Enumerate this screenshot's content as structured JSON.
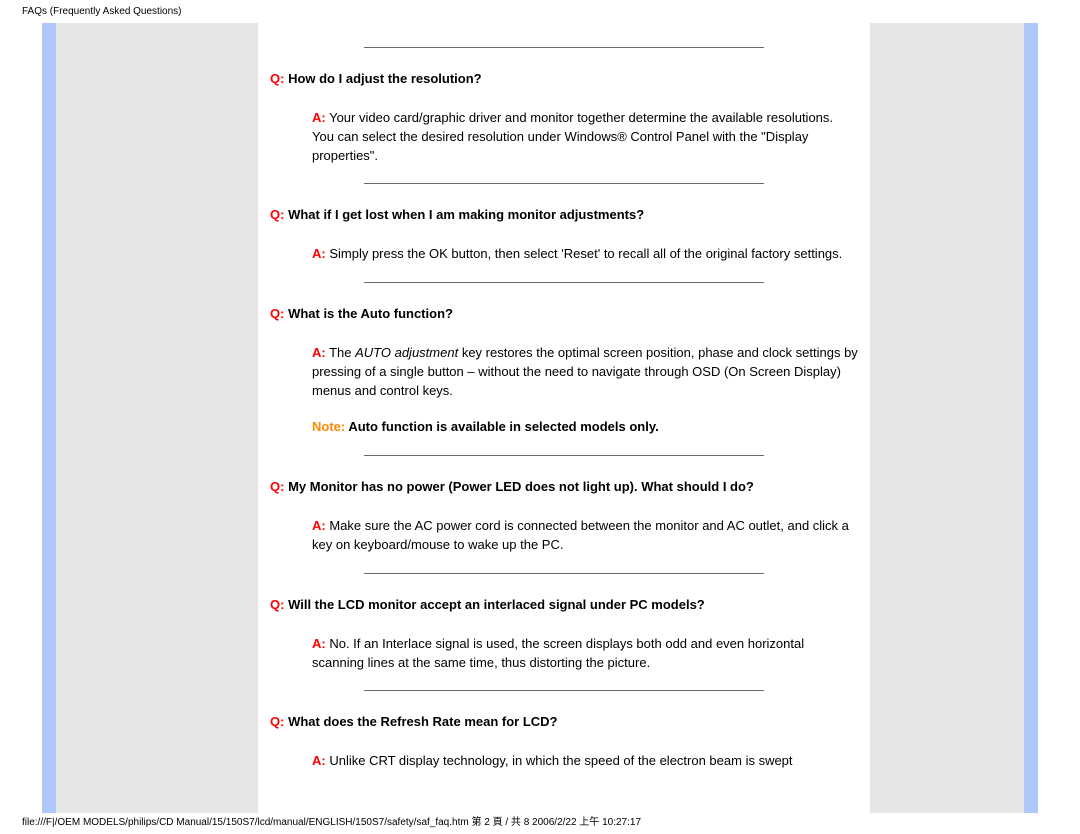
{
  "header": {
    "title": "FAQs (Frequently Asked Questions)"
  },
  "faq": [
    {
      "q_prefix": "Q:",
      "question": " How do I adjust the resolution?",
      "a_prefix": "A:",
      "answer": " Your video card/graphic driver and monitor together determine the available resolutions. You can select the desired resolution under Windows® Control Panel with the \"Display properties\"."
    },
    {
      "q_prefix": "Q:",
      "question": " What if I get lost when I am making monitor adjustments?",
      "a_prefix": "A:",
      "answer": " Simply press the OK button, then select 'Reset' to recall all of the original factory settings."
    },
    {
      "q_prefix": "Q:",
      "question": " What is the Auto function?",
      "a_prefix": "A:",
      "answer_pre": " The ",
      "answer_italic": "AUTO adjustment",
      "answer_post": " key restores the optimal screen position, phase and clock settings by pressing of a single button – without the need to navigate through OSD (On Screen Display) menus and control keys.",
      "note_prefix": "Note:",
      "note": " Auto function is available in selected models only."
    },
    {
      "q_prefix": "Q:",
      "question": " My Monitor has no power (Power LED does not light up). What should I do?",
      "a_prefix": "A:",
      "answer": " Make sure the AC power cord is connected between the monitor and AC outlet, and click a key on keyboard/mouse to wake up the PC."
    },
    {
      "q_prefix": "Q:",
      "question": " Will the LCD monitor accept an interlaced signal under PC models?",
      "a_prefix": "A:",
      "answer": " No. If an Interlace signal is used, the screen displays both odd and even horizontal scanning lines at the same time, thus distorting the picture."
    },
    {
      "q_prefix": "Q:",
      "question": " What does the Refresh Rate mean for LCD?",
      "a_prefix": "A:",
      "answer": " Unlike CRT display technology, in which the speed of the electron beam is swept"
    }
  ],
  "footer": {
    "path": "file:///F|/OEM MODELS/philips/CD Manual/15/150S7/lcd/manual/ENGLISH/150S7/safety/saf_faq.htm 第 2 頁 / 共 8 2006/2/22 上午 10:27:17"
  }
}
